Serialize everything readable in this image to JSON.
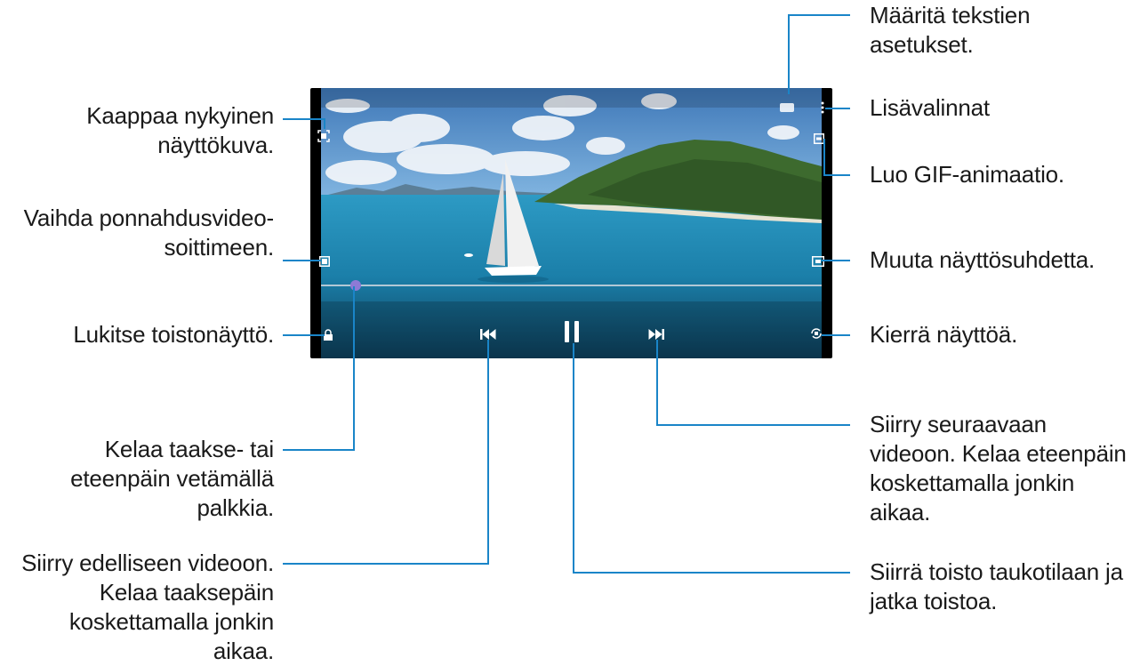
{
  "callouts": {
    "text_settings": [
      "Määritä tekstien",
      "asetukset."
    ],
    "more_options": [
      "Lisävalinnat"
    ],
    "gif": [
      "Luo GIF-animaatio."
    ],
    "ratio": [
      "Muuta näyttösuhdetta."
    ],
    "rotate": [
      "Kierrä näyttöä."
    ],
    "next": [
      "Siirry seuraavaan",
      "videoon. Kelaa eteenpäin",
      "koskettamalla jonkin",
      "aikaa."
    ],
    "pause": [
      "Siirrä toisto taukotilaan ja",
      "jatka toistoa."
    ],
    "capture": [
      "Kaappaa nykyinen",
      "näyttökuva."
    ],
    "popup": [
      "Vaihda ponnahdusvideo-",
      "soittimeen."
    ],
    "lock": [
      "Lukitse toistonäyttö."
    ],
    "seek": [
      "Kelaa taakse- tai",
      "eteenpäin vetämällä",
      "palkkia."
    ],
    "previous": [
      "Siirry edelliseen videoon.",
      "Kelaa taaksepäin",
      "koskettamalla jonkin",
      "aikaa."
    ]
  },
  "player": {
    "progress": 0.07,
    "icons": {
      "capture": "screenshot-icon",
      "popup": "popup-player-icon",
      "lock": "lock-icon",
      "text": "subtitles-icon",
      "more": "more-options-icon",
      "gif": "gif-icon",
      "ratio": "aspect-ratio-icon",
      "rotate": "rotate-icon",
      "previous": "previous-icon",
      "pause": "pause-icon",
      "next": "next-icon"
    },
    "colors": {
      "accent": "#1a85c8",
      "seek_thumb": "#8d7ad6"
    }
  }
}
